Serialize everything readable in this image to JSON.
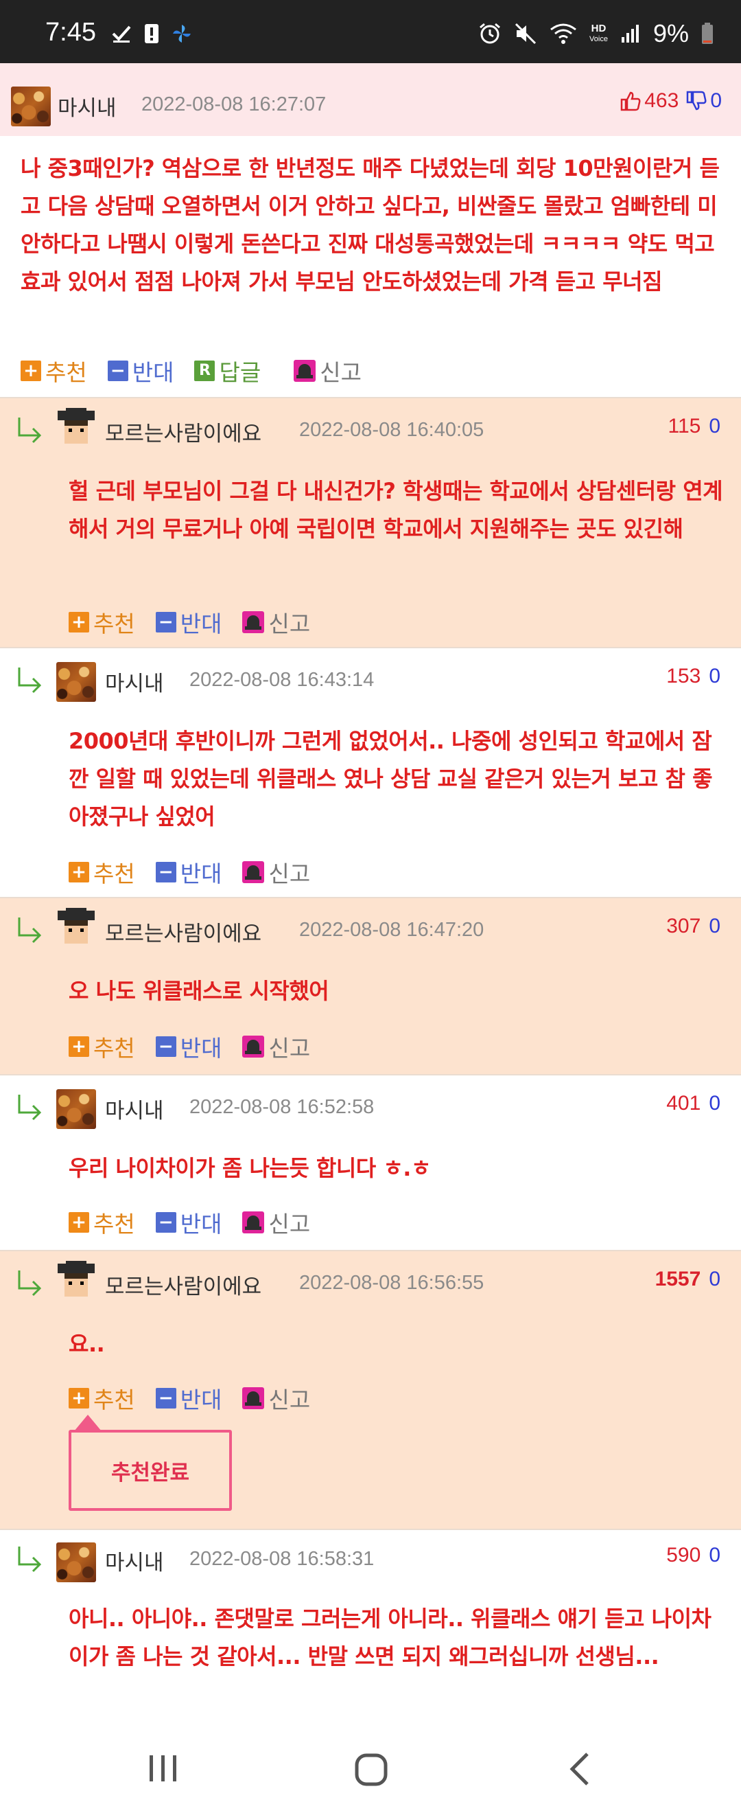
{
  "status_bar": {
    "time": "7:45",
    "battery": "9%",
    "network_label": "HD\nVoice",
    "icons": [
      "check-icon",
      "alert-icon",
      "pinwheel-icon",
      "alarm-icon",
      "mute-icon",
      "wifi-icon",
      "signal-icon",
      "battery-icon"
    ]
  },
  "post": {
    "author": "마시내",
    "date": "2022-08-08 16:27:07",
    "upvotes": "463",
    "downvotes": "0",
    "text": "나 중3때인가? 역삼으로 한 반년정도 매주 다녔었는데 회당 10만원이란거 듣고 다음 상담때 오열하면서 이거 안하고 싶다고, 비싼줄도 몰랐고 엄빠한테 미안하다고 나땜시 이렇게 돈쓴다고 진짜 대성통곡했었는데 ㅋㅋㅋㅋ 약도 먹고 효과 있어서 점점 나아져 가서 부모님 안도하셨었는데 가격 듣고 무너짐",
    "actions": {
      "recommend": "추천",
      "oppose": "반대",
      "reply": "답글",
      "reply_icon": "R",
      "report": "신고"
    }
  },
  "comments": [
    {
      "author": "모르는사람이에요",
      "date": "2022-08-08 16:40:05",
      "upvotes": "115",
      "downvotes": "0",
      "text": "헐 근데 부모님이 그걸 다 내신건가? 학생때는 학교에서 상담센터랑 연계해서 거의 무료거나 아예 국립이면 학교에서 지원해주는 곳도 있긴해"
    },
    {
      "author": "마시내",
      "date": "2022-08-08 16:43:14",
      "upvotes": "153",
      "downvotes": "0",
      "text": "2000년대 후반이니까 그런게 없었어서.. 나중에 성인되고 학교에서 잠깐 일할 때 있었는데 위클래스 였나 상담 교실 같은거 있는거 보고 참 좋아졌구나 싶었어"
    },
    {
      "author": "모르는사람이에요",
      "date": "2022-08-08 16:47:20",
      "upvotes": "307",
      "downvotes": "0",
      "text": "오 나도 위클래스로 시작했어"
    },
    {
      "author": "마시내",
      "date": "2022-08-08 16:52:58",
      "upvotes": "401",
      "downvotes": "0",
      "text": "우리 나이차이가 좀 나는듯 합니다 ㅎ.ㅎ"
    },
    {
      "author": "모르는사람이에요",
      "date": "2022-08-08 16:56:55",
      "upvotes": "1557",
      "downvotes": "0",
      "text": "요.."
    },
    {
      "author": "마시내",
      "date": "2022-08-08 16:58:31",
      "upvotes": "590",
      "downvotes": "0",
      "text": "아니.. 아니야.. 존댓말로 그러는게 아니라.. 위클래스 얘기 듣고 나이차이가 좀 나는 것 같아서... 반말 쓰면 되지 왜그러십니까 선생님..."
    }
  ],
  "comment_actions": {
    "recommend": "추천",
    "oppose": "반대",
    "report": "신고"
  },
  "recommend_done": "추천완료",
  "colors": {
    "post_header_bg": "#fde7e9",
    "peach_bg": "#fde3cf",
    "text_red": "#e02020",
    "up_red": "#d9212c",
    "down_blue": "#2e3bd6",
    "recommend_orange": "#f08a18",
    "oppose_blue": "#4f6bcf",
    "report_magenta": "#e0239a"
  },
  "nav_bar": {
    "icons": [
      "recent-apps-icon",
      "home-icon",
      "back-icon"
    ]
  }
}
